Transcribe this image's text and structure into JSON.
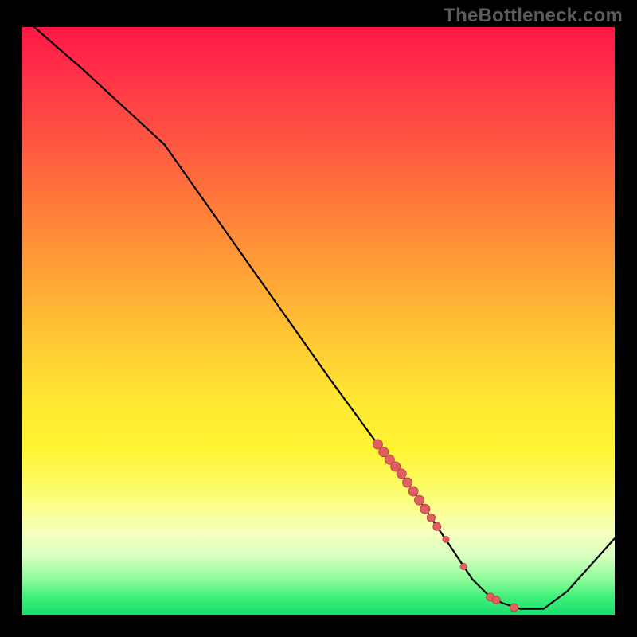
{
  "watermark": "TheBottleneck.com",
  "chart_data": {
    "type": "line",
    "title": "",
    "xlabel": "",
    "ylabel": "",
    "xlim": [
      0,
      100
    ],
    "ylim": [
      0,
      100
    ],
    "series": [
      {
        "name": "curve",
        "x": [
          2,
          10,
          24,
          38,
          52,
          60,
          64,
          68,
          72,
          76,
          79,
          81,
          84,
          88,
          92,
          100
        ],
        "y": [
          100,
          93,
          80,
          60,
          40,
          29,
          24,
          18,
          12,
          6,
          3,
          2,
          1,
          1,
          4,
          13
        ]
      }
    ],
    "points_on_curve": [
      {
        "x": 60.0,
        "y": 29.0,
        "r": 6
      },
      {
        "x": 61.0,
        "y": 27.7,
        "r": 6
      },
      {
        "x": 62.0,
        "y": 26.4,
        "r": 6
      },
      {
        "x": 63.0,
        "y": 25.2,
        "r": 6
      },
      {
        "x": 64.0,
        "y": 24.0,
        "r": 6
      },
      {
        "x": 65.0,
        "y": 22.5,
        "r": 6
      },
      {
        "x": 66.0,
        "y": 21.0,
        "r": 6
      },
      {
        "x": 67.0,
        "y": 19.5,
        "r": 6
      },
      {
        "x": 68.0,
        "y": 18.0,
        "r": 6
      },
      {
        "x": 69.0,
        "y": 16.5,
        "r": 5
      },
      {
        "x": 70.0,
        "y": 15.0,
        "r": 5
      },
      {
        "x": 71.5,
        "y": 12.8,
        "r": 4
      },
      {
        "x": 74.5,
        "y": 8.2,
        "r": 4
      },
      {
        "x": 79.0,
        "y": 3.0,
        "r": 5
      },
      {
        "x": 80.0,
        "y": 2.5,
        "r": 5
      },
      {
        "x": 83.0,
        "y": 1.2,
        "r": 5
      }
    ],
    "colors": {
      "curve": "#000000",
      "points_fill": "#e06060",
      "points_stroke": "#b84848"
    }
  }
}
